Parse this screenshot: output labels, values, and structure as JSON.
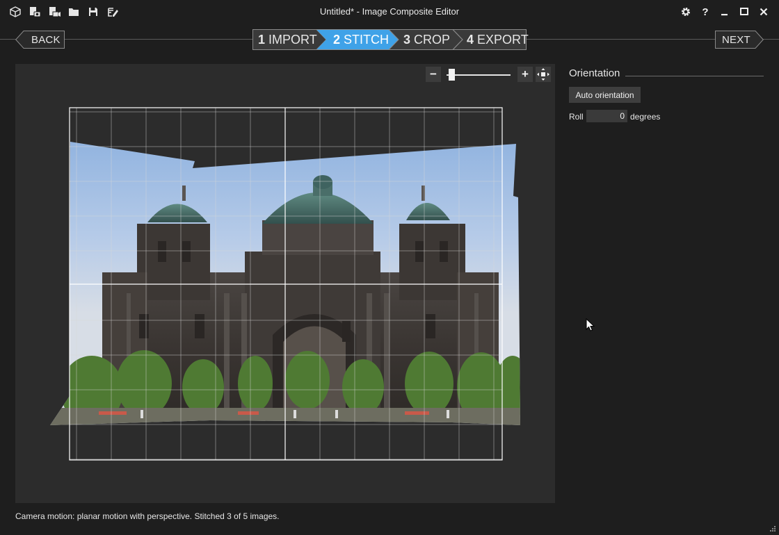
{
  "window": {
    "title": "Untitled* - Image Composite Editor",
    "toolbar_icons": [
      "new-project-icon",
      "new-panorama-from-images-icon",
      "new-panorama-from-video-icon",
      "open-project-icon",
      "save-project-icon",
      "export-panorama-icon"
    ]
  },
  "wizard": {
    "back_label": "BACK",
    "next_label": "NEXT",
    "steps": [
      {
        "number": "1",
        "label": "IMPORT"
      },
      {
        "number": "2",
        "label": "STITCH"
      },
      {
        "number": "3",
        "label": "CROP"
      },
      {
        "number": "4",
        "label": "EXPORT"
      }
    ],
    "active_step": 2
  },
  "zoom": {
    "minus_label": "−",
    "plus_label": "+",
    "level": 0.05
  },
  "orientation": {
    "heading": "Orientation",
    "auto_button_label": "Auto orientation",
    "roll_label": "Roll",
    "roll_value": "0",
    "roll_unit": "degrees"
  },
  "status": "Camera motion: planar motion with perspective. Stitched 3 of 5 images.",
  "colors": {
    "background": "#1e1e1e",
    "canvas": "#2c2c2c",
    "active_step": "#3fa2e8",
    "inactive_step": "#3a3a3a"
  }
}
